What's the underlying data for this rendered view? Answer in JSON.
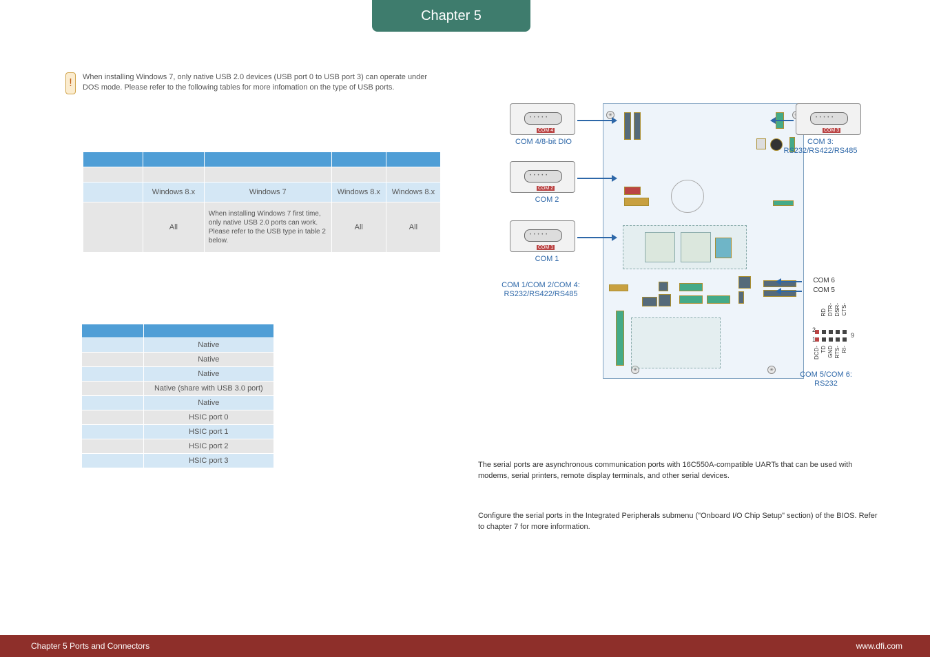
{
  "chapter_tab": "Chapter 5",
  "note": {
    "icon_char": "!",
    "text": "When installing Windows 7, only native USB 2.0 devices (USB port 0 to USB port 3) can operate under DOS mode. Please refer to the following tables for more infomation on the type of USB ports."
  },
  "table1": {
    "row3": [
      "Windows 8.x",
      "Windows 7",
      "Windows 8.x",
      "Windows 8.x"
    ],
    "row4": [
      "All",
      "When installing Windows 7 first time, only native USB 2.0 ports can work. Please refer to the USB type in table 2 below.",
      "All",
      "All"
    ]
  },
  "table2": {
    "col2": [
      "Native",
      "Native",
      "Native",
      "Native (share with USB 3.0 port)",
      "Native",
      "HSIC port 0",
      "HSIC port 1",
      "HSIC port 2",
      "HSIC port 3"
    ]
  },
  "diagram": {
    "com4_top": "COM 4/8-bit DIO",
    "com3_top": "COM 3:",
    "com3_sub": "RS232/RS422/RS485",
    "com2": "COM 2",
    "com1": "COM 1",
    "com124_title": "COM 1/COM 2/COM 4:",
    "com124_sub": "RS232/RS422/RS485",
    "com6": "COM 6",
    "com5": "COM 5",
    "pin_num2": "2",
    "pin_num1": "1",
    "pin_num9": "9",
    "pin_top_labels": [
      "CTS-",
      "DSR-",
      "DTR-",
      "RD"
    ],
    "pin_bot_labels": [
      "RI-",
      "RTS-",
      "GND",
      "TD",
      "DCD-"
    ],
    "com56_title": "COM 5/COM 6:",
    "com56_sub": "RS232"
  },
  "paragraphs": {
    "p1": "The serial ports are asynchronous communication ports with 16C550A-compatible UARTs that can be used with modems, serial printers, remote display terminals, and other serial devices.",
    "p2": "Configure the serial ports in the Integrated Peripherals submenu (\"Onboard I/O Chip Setup\" section) of the BIOS. Refer to chapter 7 for more information."
  },
  "footer": {
    "left": "Chapter 5 Ports and Connectors",
    "right": "www.dfi.com"
  }
}
